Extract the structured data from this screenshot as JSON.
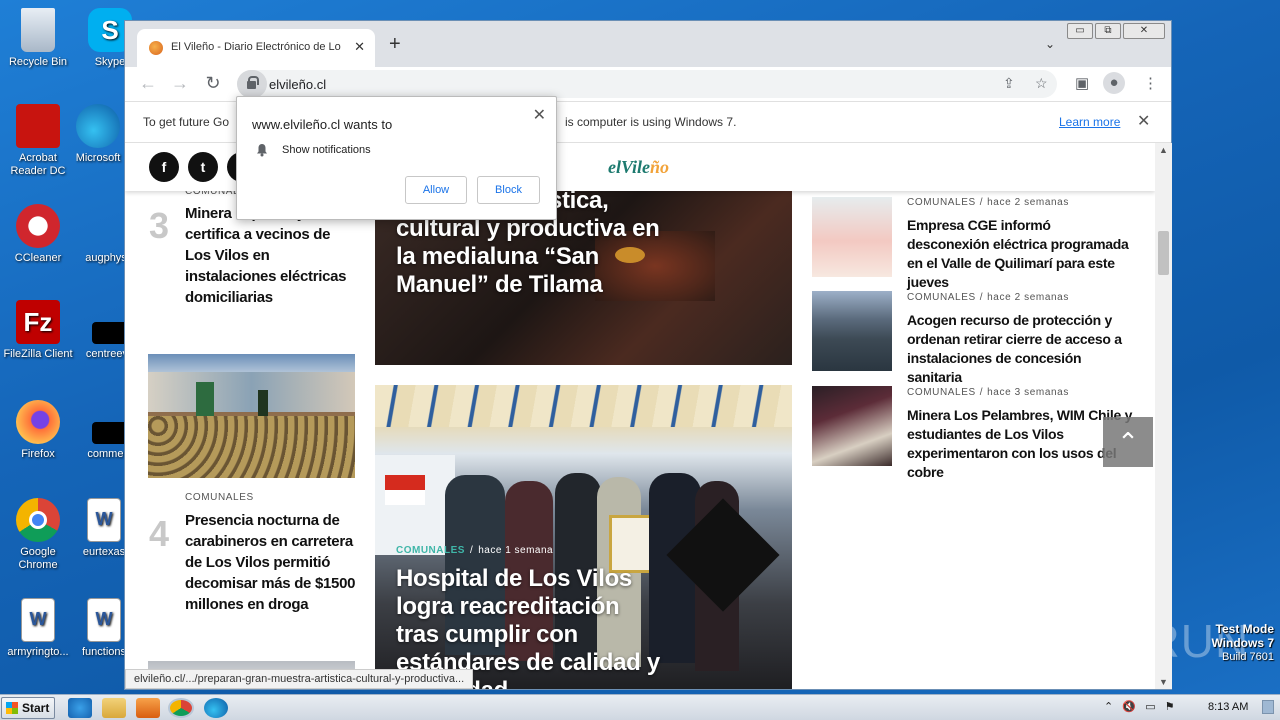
{
  "desktop": {
    "icons": [
      {
        "label": "Recycle Bin"
      },
      {
        "label": "Skype"
      },
      {
        "label": "Acrobat Reader DC"
      },
      {
        "label": "Microsoft"
      },
      {
        "label": "CCleaner"
      },
      {
        "label": "augphysic"
      },
      {
        "label": "FileZilla Client"
      },
      {
        "label": "centreeve"
      },
      {
        "label": "Firefox"
      },
      {
        "label": "comment"
      },
      {
        "label": "Google Chrome"
      },
      {
        "label": "eurtexas"
      },
      {
        "label": "armyringto..."
      },
      {
        "label": "functions"
      }
    ],
    "watermark": {
      "line1": "Test Mode",
      "line2": "Windows 7",
      "line3": "Build 7601"
    },
    "brand": "ANY RUN"
  },
  "browser": {
    "tab_title": "El Vileño - Diario Electrónico de Los Vilos",
    "url": "elvileño.cl",
    "infobar": {
      "text_left": "To get future Go",
      "text_right": "is computer is using Windows 7.",
      "learn_more": "Learn more"
    },
    "status_url": "elvileño.cl/.../preparan-gran-muestra-artistica-cultural-y-productiva..."
  },
  "popup": {
    "title": "www.elvileño.cl wants to",
    "permission": "Show notifications",
    "allow": "Allow",
    "block": "Block"
  },
  "site": {
    "logo_a": "elVile",
    "logo_b": "ño",
    "social": [
      "f",
      "t"
    ],
    "left_list": [
      {
        "num": "3",
        "category": "COMUNALES",
        "title": "Minera capacita y certifica a vecinos de Los Vilos en instalaciones eléctricas domiciliarias"
      },
      {
        "num": "4",
        "category": "COMUNALES",
        "title": "Presencia nocturna de carabineros en carretera de Los Vilos permitió decomisar más de $1500 millones en droga"
      }
    ],
    "feature_top": {
      "title": "...muestra artística, cultural y productiva en la medialuna “San Manuel” de Tilama"
    },
    "feature_main": {
      "category": "COMUNALES",
      "time": "hace 1 semana",
      "title": "Hospital de Los Vilos logra reacreditación tras cumplir con estándares de calidad y seguridad"
    },
    "right_list": [
      {
        "category": "COMUNALES",
        "time": "hace 2 semanas",
        "title": "Empresa CGE informó desconexión eléctrica programada en el Valle de Quilimarí para este jueves"
      },
      {
        "category": "COMUNALES",
        "time": "hace 2 semanas",
        "title": "Acogen recurso de protección y ordenan retirar cierre de acceso a instalaciones de concesión sanitaria"
      },
      {
        "category": "COMUNALES",
        "time": "hace 3 semanas",
        "title": "Minera Los Pelambres, WIM Chile y estudiantes de Los Vilos experimentaron con los usos del cobre"
      }
    ]
  },
  "taskbar": {
    "start": "Start",
    "clock": "8:13 AM"
  }
}
